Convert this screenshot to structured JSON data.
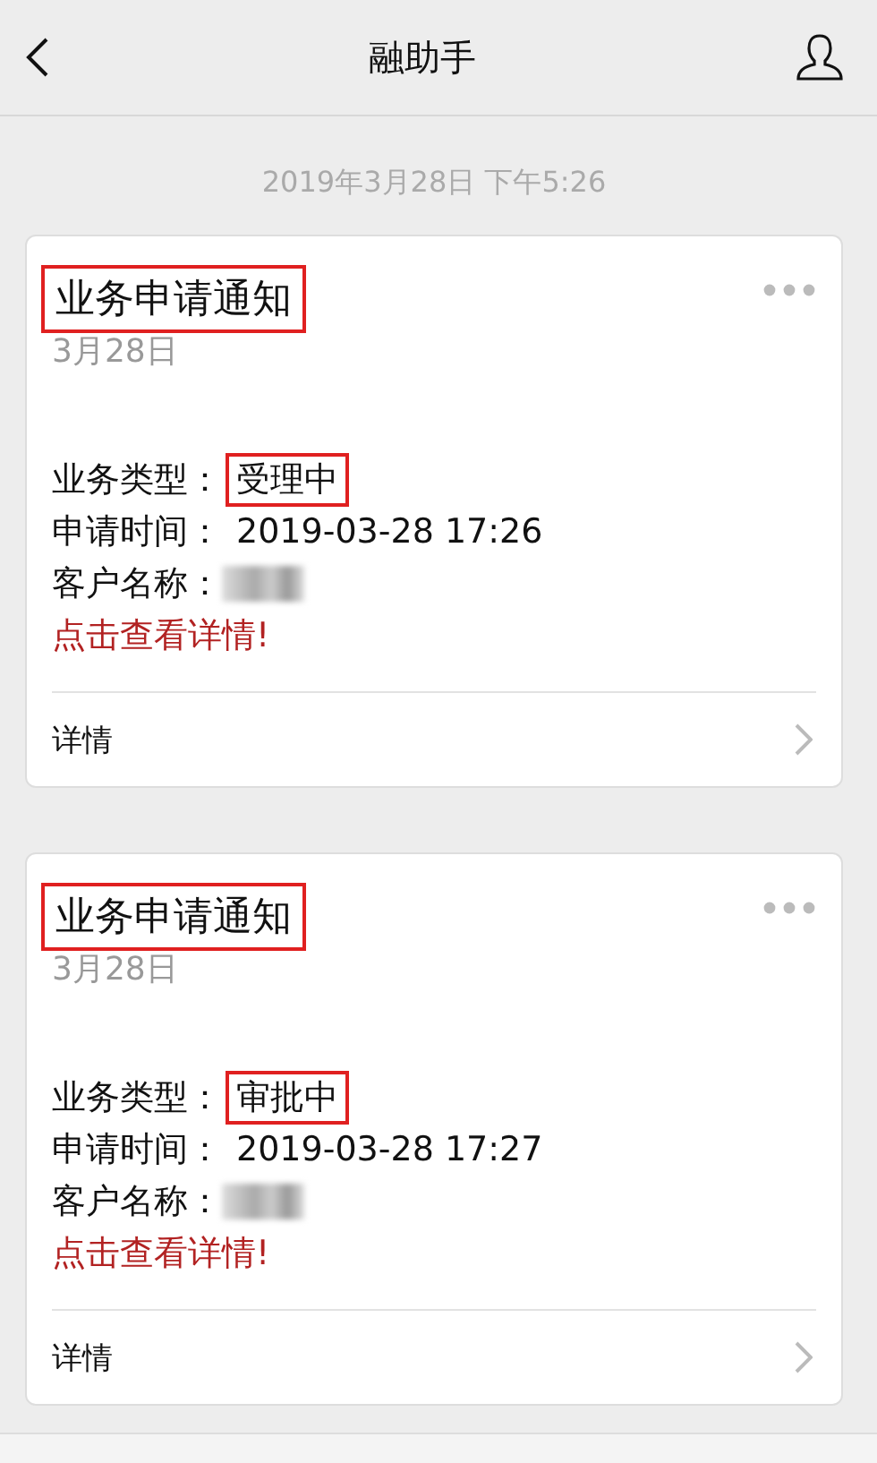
{
  "header": {
    "title": "融助手"
  },
  "timestamp": "2019年3月28日 下午5:26",
  "cards": [
    {
      "title": {
        "text": "业务申请通知",
        "marked": true
      },
      "date": "3月28日",
      "fields": [
        {
          "label": "业务类型：",
          "value": "受理中",
          "marked": true
        },
        {
          "label": "申请时间：",
          "value": "2019-03-28 17:26",
          "marked": false
        },
        {
          "label": "客户名称：",
          "redacted": true
        }
      ],
      "link": "点击查看详情!",
      "footer": "详情"
    },
    {
      "title": {
        "text": "业务申请通知",
        "marked": true
      },
      "date": "3月28日",
      "fields": [
        {
          "label": "业务类型：",
          "value": "审批中",
          "marked": true
        },
        {
          "label": "申请时间：",
          "value": "2019-03-28 17:27",
          "marked": false
        },
        {
          "label": "客户名称：",
          "redacted": true
        }
      ],
      "link": "点击查看详情!",
      "footer": "详情"
    }
  ]
}
